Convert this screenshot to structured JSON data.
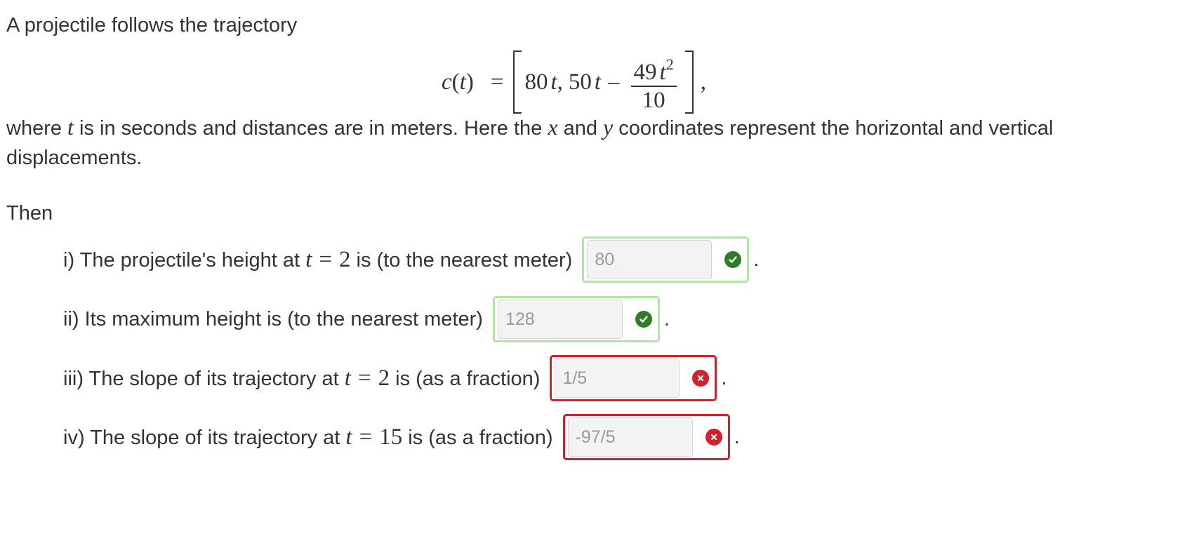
{
  "intro": "A projectile follows the trajectory",
  "equation": {
    "lhs_func": "c",
    "lhs_var": "t",
    "equals": "=",
    "first_coef": "80",
    "var": "t",
    "separator": ",",
    "second_coef": "50",
    "minus": "–",
    "frac_num_coef": "49",
    "frac_num_var": "t",
    "frac_num_exp": "2",
    "frac_den": "10",
    "trailing": ","
  },
  "description": {
    "p1": "where ",
    "var_t": "t",
    "p2": " is in seconds and distances are in meters. Here the ",
    "var_x": "x",
    "p3": " and ",
    "var_y": "y",
    "p4": " coordinates represent the horizontal and vertical displacements."
  },
  "then_label": "Then",
  "questions": [
    {
      "prefix": "i) The projectile's height at ",
      "math_var": "t",
      "math_eq": "=",
      "math_val": "2",
      "suffix": " is (to the nearest meter)",
      "answer": "80",
      "status": "correct",
      "period": "."
    },
    {
      "prefix": "ii) Its maximum height is (to the nearest meter)",
      "answer": "128",
      "status": "correct",
      "period": "."
    },
    {
      "prefix": "iii) The slope of its trajectory at ",
      "math_var": "t",
      "math_eq": "=",
      "math_val": "2",
      "suffix": " is (as a fraction)",
      "answer": "1/5",
      "status": "incorrect",
      "period": "."
    },
    {
      "prefix": "iv) The slope of its trajectory at ",
      "math_var": "t",
      "math_eq": "=",
      "math_val": "15",
      "suffix": " is (as a fraction)",
      "answer": "-97/5",
      "status": "incorrect",
      "period": "."
    }
  ],
  "colors": {
    "correct_border": "#b0e6a4",
    "correct_icon": "#2e7d26",
    "incorrect_border": "#d3212a",
    "incorrect_icon": "#d3212a"
  },
  "icons": {
    "correct": "check-circle-icon",
    "incorrect": "x-circle-icon"
  }
}
